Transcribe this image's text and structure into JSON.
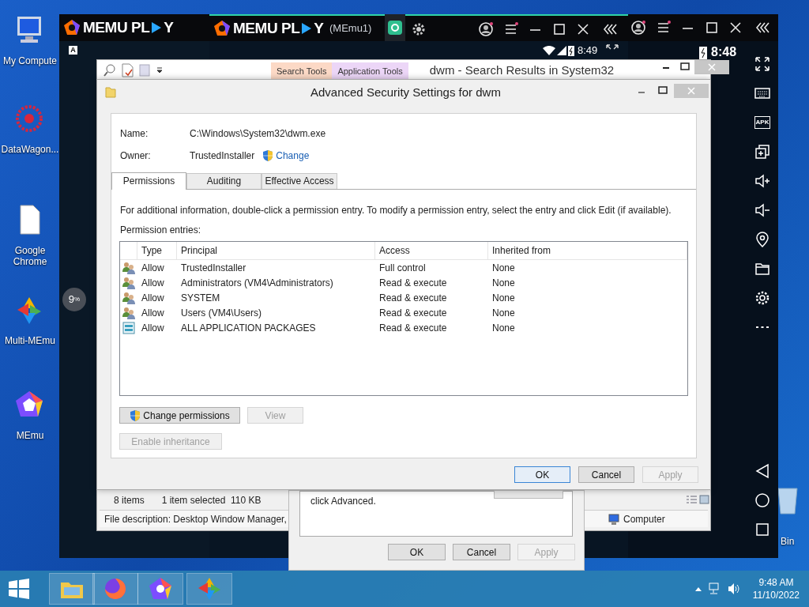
{
  "desktop_icons": [
    {
      "label": "My Compute",
      "kind": "computer"
    },
    {
      "label": "DataWagon...",
      "kind": "wagon"
    },
    {
      "label": "Google Chrome",
      "kind": "file"
    },
    {
      "label": "Multi-MEmu",
      "kind": "multi"
    },
    {
      "label": "MEmu",
      "kind": "memu"
    }
  ],
  "recycle_bin": {
    "label": "Bin"
  },
  "emulator_back": {
    "logo_left": "MEMU PL",
    "logo_right": "Y",
    "key_hint": "A"
  },
  "emulator_front": {
    "logo_left": "MEMU PL",
    "logo_right": "Y",
    "instance": "(MEmu1)",
    "clock": "8:49"
  },
  "emulator_side": {
    "clock": "8:48",
    "apk": "APK"
  },
  "loading_badge": {
    "value": "9",
    "unit": "%"
  },
  "explorer": {
    "ribbon_tabs": [
      {
        "label": "Search Tools",
        "color": "#fcd9c6"
      },
      {
        "label": "Application Tools",
        "color": "#ecd6f7"
      }
    ],
    "title": "dwm - Search Results in System32",
    "item_count": "8 items",
    "selection": "1 item selected  110 KB",
    "details": "File description: Desktop Window Manager,",
    "location": "Computer"
  },
  "properties_dialog": {
    "text": "click Advanced.",
    "buttons": [
      {
        "label": "OK",
        "disabled": false
      },
      {
        "label": "Cancel",
        "disabled": false
      },
      {
        "label": "Apply",
        "disabled": true
      }
    ]
  },
  "security_dialog": {
    "title": "Advanced Security Settings for dwm",
    "fields": [
      {
        "label": "Name:",
        "value": "C:\\Windows\\System32\\dwm.exe"
      },
      {
        "label": "Owner:",
        "value": "TrustedInstaller"
      }
    ],
    "owner_link": "Change",
    "tabs": [
      {
        "label": "Permissions",
        "selected": true
      },
      {
        "label": "Auditing",
        "selected": false
      },
      {
        "label": "Effective Access",
        "selected": false
      }
    ],
    "info": "For additional information, double-click a permission entry. To modify a permission entry, select the entry and click Edit (if available).",
    "entries_label": "Permission entries:",
    "columns": [
      "Type",
      "Principal",
      "Access",
      "Inherited from"
    ],
    "rows": [
      {
        "kind": "group",
        "type": "Allow",
        "principal": "TrustedInstaller",
        "access": "Full control",
        "inherited": "None"
      },
      {
        "kind": "group",
        "type": "Allow",
        "principal": "Administrators (VM4\\Administrators)",
        "access": "Read & execute",
        "inherited": "None"
      },
      {
        "kind": "group",
        "type": "Allow",
        "principal": "SYSTEM",
        "access": "Read & execute",
        "inherited": "None"
      },
      {
        "kind": "group",
        "type": "Allow",
        "principal": "Users (VM4\\Users)",
        "access": "Read & execute",
        "inherited": "None"
      },
      {
        "kind": "package",
        "type": "Allow",
        "principal": "ALL APPLICATION PACKAGES",
        "access": "Read & execute",
        "inherited": "None"
      }
    ],
    "actions": [
      {
        "label": "Change permissions",
        "disabled": false,
        "shield": true
      },
      {
        "label": "View",
        "disabled": true,
        "shield": false
      }
    ],
    "inheritance": {
      "label": "Enable inheritance",
      "disabled": true
    },
    "buttons": [
      {
        "label": "OK",
        "disabled": false,
        "default": true
      },
      {
        "label": "Cancel",
        "disabled": false,
        "default": false
      },
      {
        "label": "Apply",
        "disabled": true,
        "default": false
      }
    ]
  },
  "taskbar": {
    "time": "9:48 AM",
    "date": "11/10/2022"
  }
}
